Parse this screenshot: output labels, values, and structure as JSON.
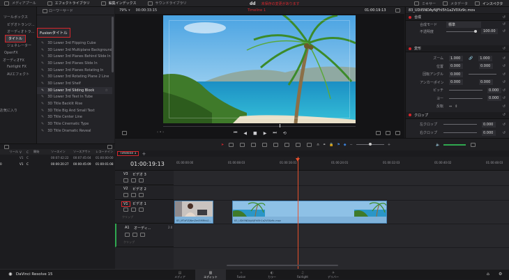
{
  "topbar": {
    "left_items": [
      "メディアプール",
      "エフェクトライブラリ",
      "編集インデックス",
      "サウンドライブラリ"
    ],
    "project_name": "dd",
    "red_notice": "未保存の変更があります",
    "right_items": [
      "ミキサー",
      "メタデータ",
      "インスペクタ"
    ]
  },
  "effects_tree": {
    "items": [
      "ツールボックス",
      "ビデオトランジ...",
      "オーディオトラ...",
      "タイトル",
      "ジェネレーター",
      "OpenFX",
      "オーディオFX",
      "Fairlight FX",
      "AUエフェクト"
    ],
    "selected": "タイトル",
    "favorites": "お気に入り"
  },
  "titles_list": {
    "header": "ローワーサード",
    "section_title": "Fusionタイトル",
    "items": [
      "3D Lower 3rd Flipping Cube",
      "3D Lower 3rd Multiplane Background",
      "3D Lower 3rd Planes Behind Slide In",
      "3D Lower 3rd Planes Slide In",
      "3D Lower 3rd Planes Rotating In",
      "3D Lower 3rd Rotating Plane 2 Line",
      "3D Lower 3rd Shelf",
      "3D Lower 3rd Sliding Block",
      "3D Lower 3rd Text In Tube",
      "3D Title Backlit Rise",
      "3D Title Big And Small Text",
      "3D Title Center Line",
      "3D Title Cinematic Type",
      "3D Title Dramatic Reveal"
    ],
    "hovered": "3D Lower 3rd Sliding Block"
  },
  "viewer": {
    "zoom": "79%",
    "source_timecode": "00:00:33:15",
    "timeline_name": "Timeline 1",
    "record_timecode": "01:00:19:13"
  },
  "inspector": {
    "clip_name": "83_UDiI5NDAyNjFhI5h1a2V0Xz9c.mov",
    "composite": {
      "title": "合成",
      "mode_label": "合成モード",
      "mode_value": "標準",
      "opacity_label": "不透明度",
      "opacity_value": "100.00"
    },
    "transform": {
      "title": "変形",
      "rows": [
        {
          "label": "ズーム",
          "x": "1.000",
          "y": "1.000"
        },
        {
          "label": "位置",
          "x": "0.000",
          "y": "0.000"
        },
        {
          "label": "回転アングル",
          "x": "0.000",
          "y": ""
        },
        {
          "label": "アンカーポイント",
          "x": "0.000",
          "y": "0.000"
        },
        {
          "label": "ピッチ",
          "x": "",
          "y": "0.000"
        },
        {
          "label": "ヨー",
          "x": "",
          "y": "0.000"
        },
        {
          "label": "反転",
          "x": "",
          "y": ""
        }
      ]
    },
    "crop": {
      "title": "クロップ",
      "rows": [
        {
          "label": "左クロップ",
          "value": "0.000"
        },
        {
          "label": "右クロップ",
          "value": "0.000"
        }
      ]
    }
  },
  "media_table": {
    "columns": [
      "リール",
      "V",
      "C",
      "開始",
      "ソースイン",
      "ソースアウト",
      "レコードイン"
    ],
    "rows": [
      [
        "",
        "V1",
        "C",
        "",
        "00:07:42:22",
        "00:07:45:04",
        "01:00:00:00"
      ],
      [
        "0",
        "V1",
        "C",
        "",
        "00:00:20:27",
        "00:00:45:09",
        "01:00:01:08"
      ]
    ]
  },
  "timeline": {
    "tab_name": "Timeline 1",
    "timecode": "01:00:19:13",
    "ruler": [
      "01:00:00:00",
      "01:00:08:03",
      "01:00:16:01",
      "01:00:24:01",
      "01:00:32:03",
      "01:00:40:02",
      "01:00:48:03"
    ],
    "tracks": [
      {
        "id": "V3",
        "name": "ビデオ 3",
        "note": ""
      },
      {
        "id": "V2",
        "name": "ビデオ 2",
        "note": ""
      },
      {
        "id": "V1",
        "name": "ビデオ 1",
        "note": "クリップ"
      },
      {
        "id": "A1",
        "name": "オーディ...",
        "note": "2.0",
        "sub": "クリップ"
      }
    ],
    "clips": [
      {
        "name": "83_MTzFlZjNmZmI5MRhb2...",
        "thumb": "person"
      },
      {
        "name": "83_UDiI5NDAyNjFhI5h1a2V0Xz9c.mov",
        "thumb": "palm"
      }
    ]
  },
  "bottombar": {
    "app_name": "DaVinci Resolve 15",
    "pages": [
      "メディア",
      "エディット",
      "Fusion",
      "カラー",
      "Fairlight",
      "デリバー"
    ],
    "active_page": "エディット"
  },
  "colors": {
    "accent_red": "#d7262c",
    "clip_blue": "#7fb2da",
    "playhead": "#e8512d"
  }
}
